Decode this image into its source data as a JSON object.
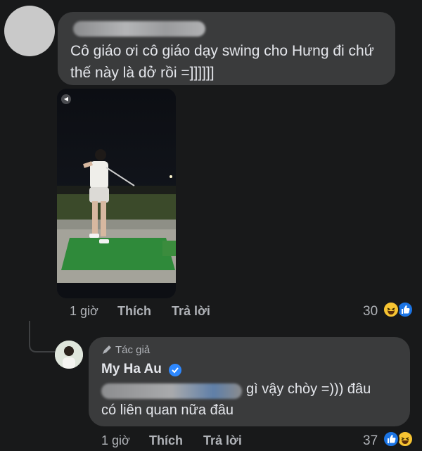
{
  "comment1": {
    "text": "Cô giáo ơi cô giáo dạy swing cho Hưng đi chứ thế này là dở rồi =]]]]]]",
    "time": "1 giờ",
    "like_label": "Thích",
    "reply_label": "Trả lời",
    "reaction_count": "30",
    "video": {
      "sound_icon": "speaker-icon"
    }
  },
  "reply1": {
    "author_badge": "Tác giả",
    "author_name": "My Ha Au",
    "text_line1": "gì vậy chòy =))) đâu",
    "text_line2": "có liên quan nữa đâu",
    "time": "1 giờ",
    "like_label": "Thích",
    "reply_label": "Trả lời",
    "reaction_count": "37"
  },
  "colors": {
    "background": "#18191a",
    "bubble": "#3a3b3c",
    "text": "#e4e6eb",
    "muted": "#b0b3b8",
    "like_blue": "#1b74e4",
    "haha_yellow": "#f7c432",
    "verified_blue": "#2d88ff"
  }
}
